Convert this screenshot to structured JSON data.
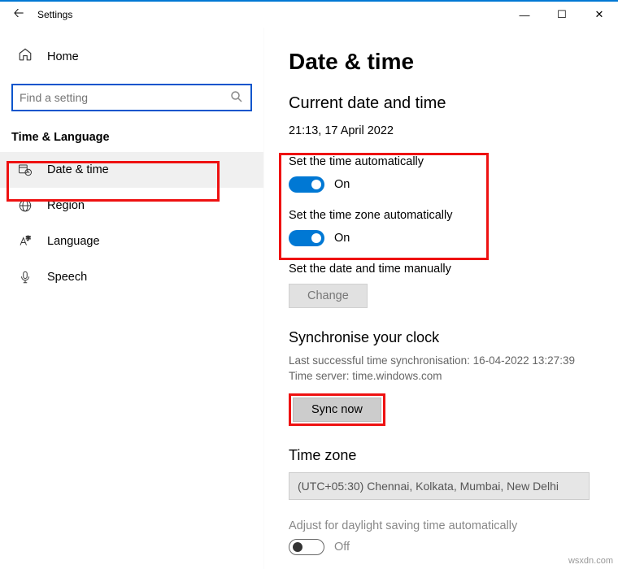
{
  "window": {
    "title": "Settings"
  },
  "sidebar": {
    "home": "Home",
    "search_placeholder": "Find a setting",
    "category": "Time & Language",
    "items": [
      {
        "label": "Date & time"
      },
      {
        "label": "Region"
      },
      {
        "label": "Language"
      },
      {
        "label": "Speech"
      }
    ]
  },
  "main": {
    "heading": "Date & time",
    "subheading": "Current date and time",
    "datetime": "21:13, 17 April 2022",
    "auto_time_label": "Set the time automatically",
    "auto_time_state": "On",
    "auto_tz_label": "Set the time zone automatically",
    "auto_tz_state": "On",
    "manual_label": "Set the date and time manually",
    "change_btn": "Change",
    "sync_heading": "Synchronise your clock",
    "sync_last": "Last successful time synchronisation: 16-04-2022 13:27:39",
    "sync_server": "Time server: time.windows.com",
    "sync_btn": "Sync now",
    "tz_heading": "Time zone",
    "tz_value": "(UTC+05:30) Chennai, Kolkata, Mumbai, New Delhi",
    "dst_label": "Adjust for daylight saving time automatically",
    "dst_state": "Off"
  },
  "watermark": "wsxdn.com"
}
